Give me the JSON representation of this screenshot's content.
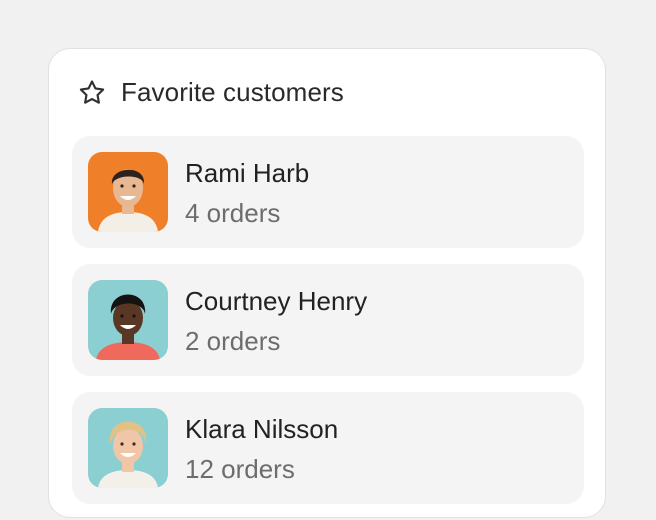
{
  "header": {
    "title": "Favorite customers",
    "icon": "star-icon"
  },
  "customers": [
    {
      "name": "Rami Harb",
      "orders": "4 orders",
      "avatar_bg": "#f07f2a",
      "skin": "#e8b893",
      "hair": "#2d221d",
      "shirt": "#f3efe6"
    },
    {
      "name": "Courtney Henry",
      "orders": "2 orders",
      "avatar_bg": "#8ccfd3",
      "skin": "#5a3625",
      "hair": "#171212",
      "shirt": "#ef6a5c"
    },
    {
      "name": "Klara Nilsson",
      "orders": "12 orders",
      "avatar_bg": "#8ccfd3",
      "skin": "#f1c6a7",
      "hair": "#e3c184",
      "shirt": "#f2f0e8"
    }
  ]
}
